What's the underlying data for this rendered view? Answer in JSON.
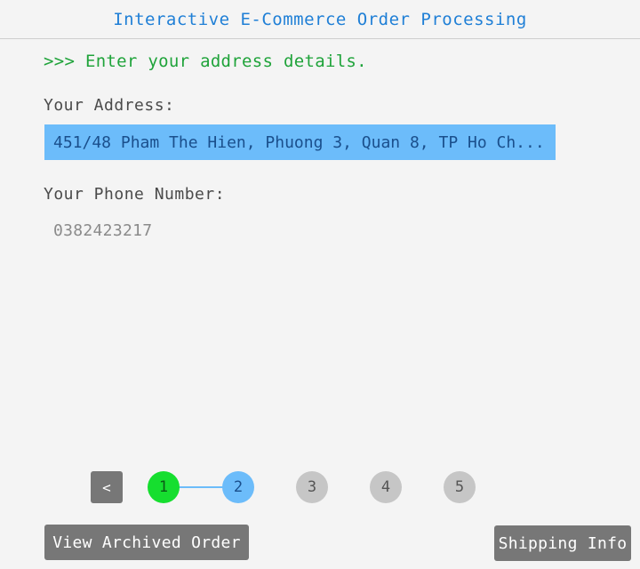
{
  "header": {
    "title": "Interactive E-Commerce Order Processing"
  },
  "prompt": ">>> Enter your address details.",
  "address": {
    "label": "Your Address:",
    "value": "451/48 Pham The Hien, Phuong 3, Quan 8, TP Ho Ch..."
  },
  "phone": {
    "label": "Your Phone Number:",
    "value": "0382423217"
  },
  "stepper": {
    "back_label": "<",
    "steps": [
      {
        "label": "1",
        "state": "done"
      },
      {
        "label": "2",
        "state": "active"
      },
      {
        "label": "3",
        "state": "pending"
      },
      {
        "label": "4",
        "state": "pending"
      },
      {
        "label": "5",
        "state": "pending"
      }
    ]
  },
  "buttons": {
    "archive_label": "View Archived Order",
    "shipping_label": "Shipping Info"
  },
  "colors": {
    "title": "#1f7fd6",
    "prompt": "#1fa33a",
    "input_active": "#6cbcfa",
    "step_done": "#16de2f",
    "step_pending": "#c6c6c6",
    "button": "#777777"
  }
}
